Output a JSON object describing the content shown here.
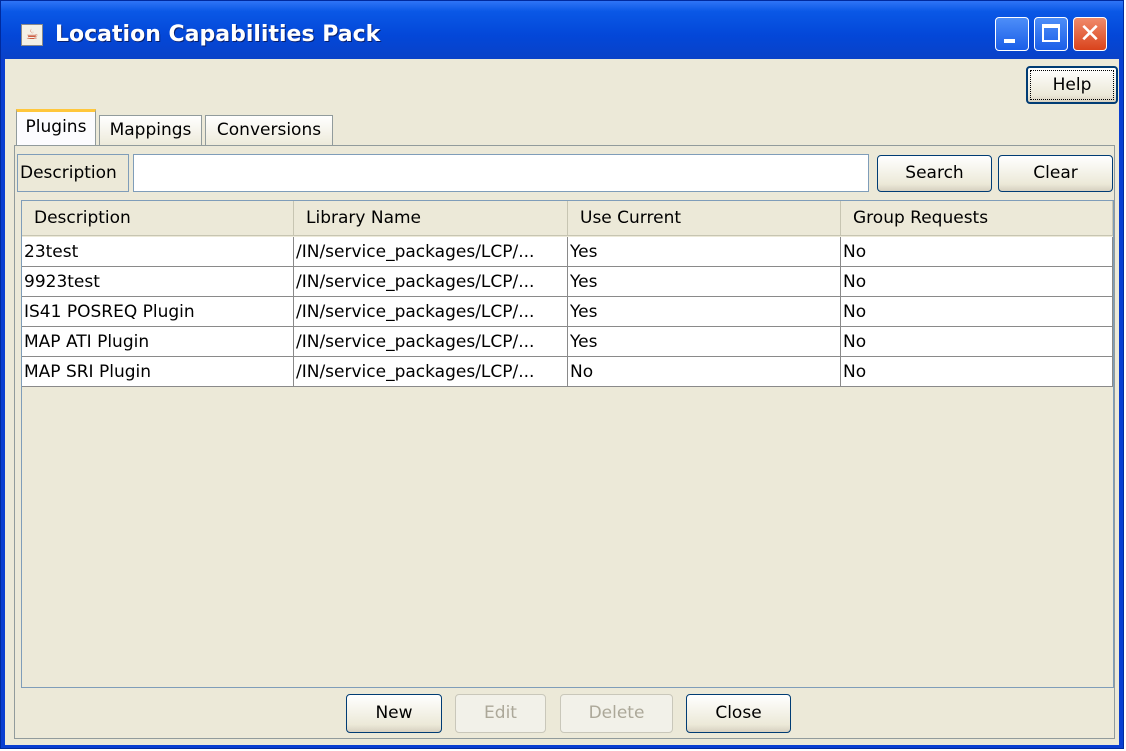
{
  "window": {
    "title": "Location Capabilities Pack",
    "icon": "java-cup-icon",
    "controls": [
      "minimize-icon",
      "maximize-icon",
      "close-icon"
    ]
  },
  "toolbar": {
    "help_label": "Help"
  },
  "tabs": [
    {
      "label": "Plugins",
      "active": true
    },
    {
      "label": "Mappings",
      "active": false
    },
    {
      "label": "Conversions",
      "active": false
    }
  ],
  "search": {
    "label": "Description",
    "value": "",
    "search_label": "Search",
    "clear_label": "Clear"
  },
  "table": {
    "columns": [
      "Description",
      "Library Name",
      "Use Current",
      "Group Requests"
    ],
    "rows": [
      [
        "23test",
        "/IN/service_packages/LCP/...",
        "Yes",
        "No"
      ],
      [
        "9923test",
        "/IN/service_packages/LCP/...",
        "Yes",
        "No"
      ],
      [
        "IS41 POSREQ Plugin",
        "/IN/service_packages/LCP/...",
        "Yes",
        "No"
      ],
      [
        "MAP ATI Plugin",
        "/IN/service_packages/LCP/...",
        "Yes",
        "No"
      ],
      [
        "MAP SRI Plugin",
        "/IN/service_packages/LCP/...",
        "No",
        "No"
      ]
    ]
  },
  "actions": {
    "new_label": "New",
    "edit_label": "Edit",
    "delete_label": "Delete",
    "close_label": "Close"
  }
}
